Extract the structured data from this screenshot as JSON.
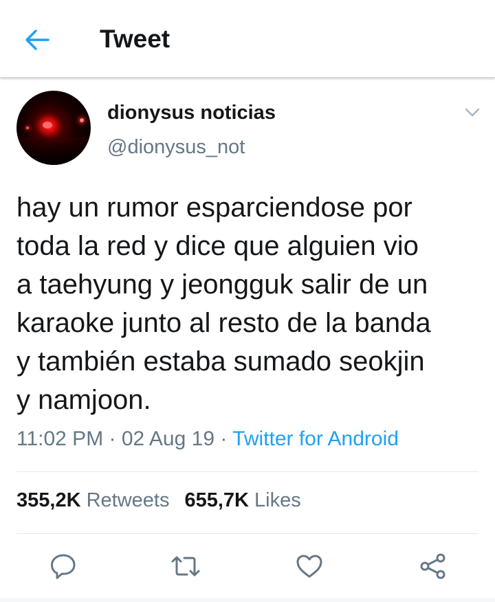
{
  "header": {
    "title": "Tweet",
    "back_icon": "arrow-left-icon"
  },
  "tweet": {
    "display_name": "dionysus noticias",
    "handle": "@dionysus_not",
    "text_lines": [
      "hay un rumor esparciendose por",
      "toda la red y dice que alguien vio",
      "a taehyung y jeongguk salir de un",
      "karaoke junto al resto de la banda",
      "y también estaba sumado seokjin",
      "y namjoon."
    ],
    "time": "11:02 PM",
    "separator": "·",
    "date": "02 Aug 19",
    "source": "Twitter for Android",
    "retweets_count": "355,2K",
    "retweets_label": "Retweets",
    "likes_count": "655,7K",
    "likes_label": "Likes"
  },
  "actions": [
    {
      "icon": "reply-icon"
    },
    {
      "icon": "retweet-icon"
    },
    {
      "icon": "like-heart-icon"
    },
    {
      "icon": "share-icon"
    }
  ],
  "colors": {
    "accent": "#1da1f2",
    "text_primary": "#14171a",
    "text_secondary": "#657786",
    "icon_gray": "#657786",
    "divider": "#e1e8ed"
  }
}
